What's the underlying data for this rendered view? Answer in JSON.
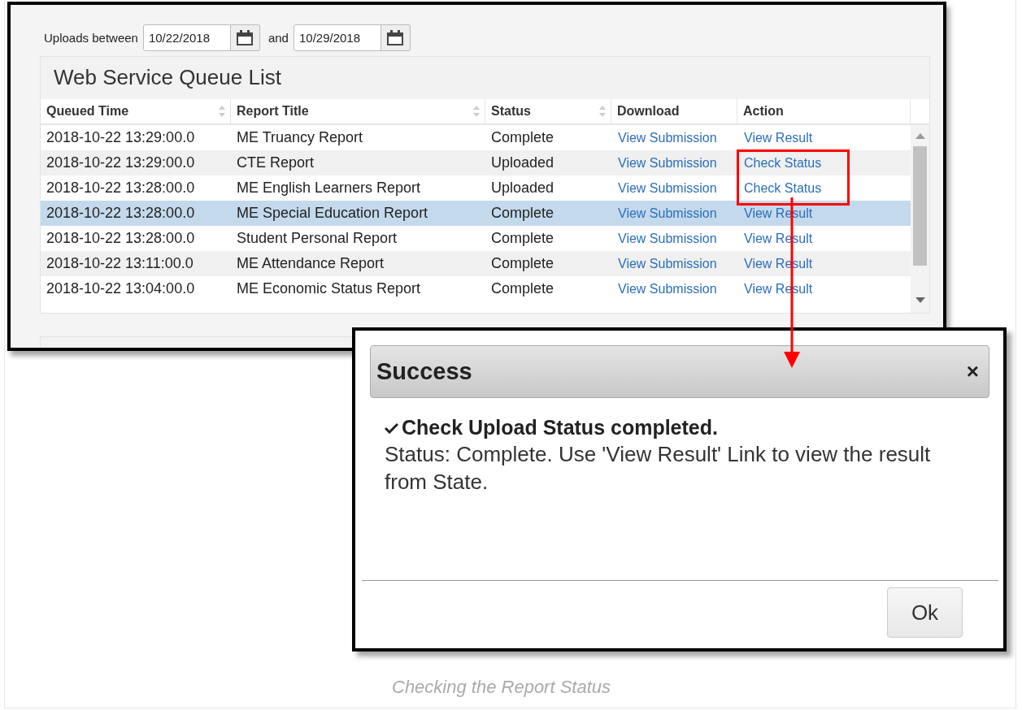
{
  "filter": {
    "label": "Uploads between",
    "start": "10/22/2018",
    "joiner": "and",
    "end": "10/29/2018"
  },
  "queue_list": {
    "title": "Web Service Queue List",
    "columns": [
      {
        "label": "Queued Time",
        "sortable": true
      },
      {
        "label": "Report Title",
        "sortable": true
      },
      {
        "label": "Status",
        "sortable": true
      },
      {
        "label": "Download",
        "sortable": false
      },
      {
        "label": "Action",
        "sortable": false
      }
    ],
    "rows": [
      {
        "queued": "2018-10-22 13:29:00.0",
        "title": "ME Truancy Report",
        "status": "Complete",
        "download": "View Submission",
        "action": "View Result",
        "selected": false,
        "highlighted": false
      },
      {
        "queued": "2018-10-22 13:29:00.0",
        "title": "CTE Report",
        "status": "Uploaded",
        "download": "View Submission",
        "action": "Check Status",
        "selected": false,
        "highlighted": true
      },
      {
        "queued": "2018-10-22 13:28:00.0",
        "title": "ME English Learners Report",
        "status": "Uploaded",
        "download": "View Submission",
        "action": "Check Status",
        "selected": false,
        "highlighted": true
      },
      {
        "queued": "2018-10-22 13:28:00.0",
        "title": "ME Special Education Report",
        "status": "Complete",
        "download": "View Submission",
        "action": "View Result",
        "selected": true,
        "highlighted": false
      },
      {
        "queued": "2018-10-22 13:28:00.0",
        "title": "Student Personal Report",
        "status": "Complete",
        "download": "View Submission",
        "action": "View Result",
        "selected": false,
        "highlighted": false
      },
      {
        "queued": "2018-10-22 13:11:00.0",
        "title": "ME Attendance Report",
        "status": "Complete",
        "download": "View Submission",
        "action": "View Result",
        "selected": false,
        "highlighted": false
      },
      {
        "queued": "2018-10-22 13:04:00.0",
        "title": "ME Economic Status Report",
        "status": "Complete",
        "download": "View Submission",
        "action": "View Result",
        "selected": false,
        "highlighted": false
      }
    ]
  },
  "dialog": {
    "title": "Success",
    "close": "×",
    "heading": "Check Upload Status completed.",
    "message": "Status: Complete. Use 'View Result' Link to view the result from State.",
    "button": "Ok"
  },
  "caption": "Checking the Report Status"
}
